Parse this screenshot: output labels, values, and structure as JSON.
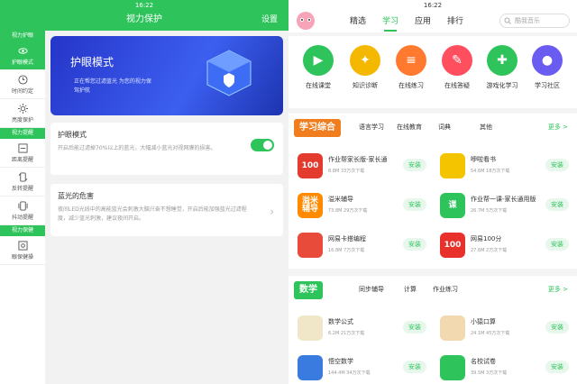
{
  "left": {
    "status_time": "16:22",
    "title": "视力保护",
    "settings": "设置",
    "sidebar": {
      "sec1": "视力护眼",
      "item_eye": "护眼模式",
      "item_time": "时间约定",
      "item_bright": "亮度保护",
      "sec2": "视力提醒",
      "item_distance": "距离提醒",
      "item_shake": "反转提醒",
      "item_jitter": "抖动提醒",
      "sec3": "视力保健",
      "item_exercise": "眼保健操"
    },
    "hero": {
      "title": "护眼模式",
      "subtitle": "正在帮您过滤蓝光 为您的视力保驾护航"
    },
    "card1": {
      "title": "护眼模式",
      "desc": "开启后能过滤掉70%以上的蓝光，大幅减小蓝光对视网膜的损害。",
      "toggle_on": true
    },
    "card2": {
      "title": "蓝光的危害",
      "desc": "夜间LED光线中的高能蓝光会刺激大脑兴奋不想睡觉，开启后能加强蓝光过滤程度，减少蓝光刺激，建议夜间开启。"
    }
  },
  "right": {
    "status_time": "16:22",
    "tabs": [
      "精选",
      "学习",
      "应用",
      "排行"
    ],
    "active_tab": "学习",
    "search_placeholder": "酷我音乐",
    "categories": [
      {
        "label": "在线课堂",
        "color": "#2ec45b"
      },
      {
        "label": "知识诊断",
        "color": "#f5b800"
      },
      {
        "label": "在线练习",
        "color": "#ff7a2f"
      },
      {
        "label": "在线答疑",
        "color": "#ff4f5e"
      },
      {
        "label": "游戏化学习",
        "color": "#2ec45b"
      },
      {
        "label": "学习社区",
        "color": "#6a5cf0"
      }
    ],
    "section1": {
      "badge": "学习综合",
      "tabs": [
        "语言学习",
        "在线教育",
        "词典",
        "其他"
      ],
      "more": "更多 >",
      "apps": [
        {
          "name": "作业帮家长版-家长通",
          "size": "8.8M",
          "downloads": "33万次下载",
          "icon_text": "100",
          "color": "#e33b2e"
        },
        {
          "name": "咿啦看书",
          "size": "54.6M",
          "downloads": "18万次下载",
          "icon_text": "",
          "color": "#f5c400"
        },
        {
          "name": "溢米辅导",
          "size": "73.8M",
          "downloads": "29万次下载",
          "icon_text": "溢米 辅导",
          "color": "#ff8a00"
        },
        {
          "name": "作业帮一课-家长通用版",
          "size": "26.7M",
          "downloads": "5万次下载",
          "icon_text": "课",
          "color": "#2ec45b"
        },
        {
          "name": "网易卡搭编程",
          "size": "16.8M",
          "downloads": "7万次下载",
          "icon_text": "",
          "color": "#e84b3a"
        },
        {
          "name": "网易100分",
          "size": "27.6M",
          "downloads": "2万次下载",
          "icon_text": "100",
          "color": "#e8312b"
        }
      ],
      "install": "安装"
    },
    "section2": {
      "badge": "数学",
      "tabs": [
        "同步辅导",
        "计算",
        "作业练习"
      ],
      "more": "更多 >",
      "apps": [
        {
          "name": "数学公式",
          "size": "6.2M",
          "downloads": "21万次下载",
          "icon_text": "",
          "color": "#f0e6c8"
        },
        {
          "name": "小猿口算",
          "size": "24.1M",
          "downloads": "45万次下载",
          "icon_text": "",
          "color": "#fff"
        },
        {
          "name": "悟空数学",
          "size": "144.4M",
          "downloads": "34万次下载",
          "icon_text": "",
          "color": "#3a7be0"
        },
        {
          "name": "名校试卷",
          "size": "39.5M",
          "downloads": "3万次下载",
          "icon_text": "",
          "color": "#2ec45b"
        }
      ],
      "install": "安装"
    }
  }
}
